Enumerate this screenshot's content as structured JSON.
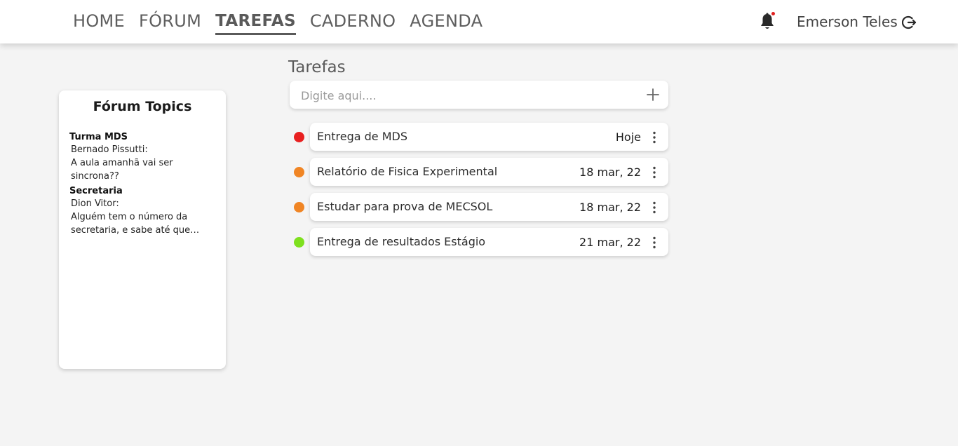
{
  "nav": {
    "items": [
      {
        "label": "HOME",
        "active": false
      },
      {
        "label": "FÓRUM",
        "active": false
      },
      {
        "label": "TAREFAS",
        "active": true
      },
      {
        "label": "CADERNO",
        "active": false
      },
      {
        "label": "AGENDA",
        "active": false
      }
    ]
  },
  "header": {
    "user_name": "Emerson Teles",
    "notification_indicator_color": "#e0201f",
    "icons": [
      "bell-icon",
      "logout-icon"
    ]
  },
  "forum": {
    "title": "Fórum Topics",
    "topics": [
      {
        "name": "Turma MDS",
        "author": "Bernado Pissutti:",
        "message": "A aula amanhã vai ser sincrona??"
      },
      {
        "name": "Secretaria",
        "author": "Dion Vitor:",
        "message": "Alguém tem o número da secretaria, e sabe até que horas..."
      }
    ]
  },
  "tasks": {
    "title": "Tarefas",
    "input_placeholder": "Digite aqui....",
    "items": [
      {
        "name": "Entrega de MDS",
        "date": "Hoje",
        "status_color": "#e82020"
      },
      {
        "name": "Relatório de Fisica Experimental",
        "date": "18 mar, 22",
        "status_color": "#f08524"
      },
      {
        "name": "Estudar para prova de MECSOL",
        "date": "18 mar, 22",
        "status_color": "#f08524"
      },
      {
        "name": "Entrega de resultados Estágio",
        "date": "21 mar, 22",
        "status_color": "#7ee01e"
      }
    ]
  }
}
